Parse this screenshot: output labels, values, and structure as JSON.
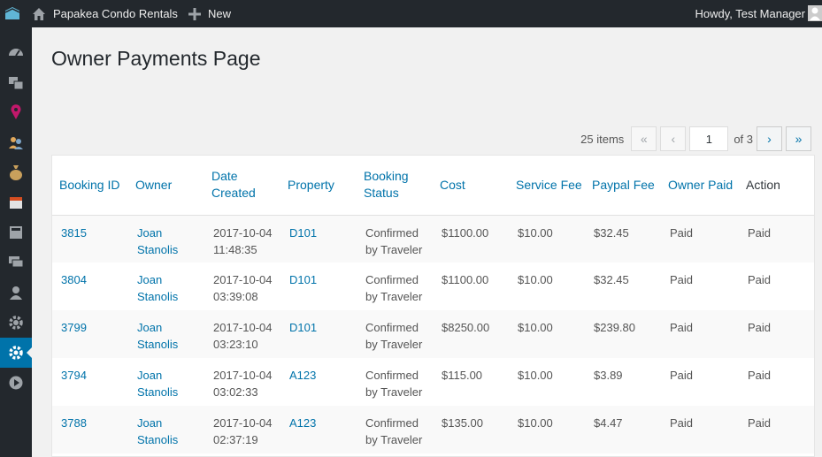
{
  "adminbar": {
    "site_name": "Papakea Condo Rentals",
    "new_label": "New",
    "greeting": "Howdy, Test Manager"
  },
  "sidebar": {
    "icons": [
      "dashboard-icon",
      "media-icon",
      "location-icon",
      "users-group-icon",
      "money-bag-icon",
      "calendar-icon",
      "calculator-icon",
      "comments-icon",
      "user-icon",
      "settings-icon",
      "settings-active-icon",
      "play-icon"
    ]
  },
  "page": {
    "title": "Owner Payments Page"
  },
  "pagination": {
    "items": "25 items",
    "first": "«",
    "prev": "‹",
    "current": "1",
    "of": "of 3",
    "next": "›",
    "last": "»"
  },
  "table": {
    "headers": [
      "Booking ID",
      "Owner",
      "Date Created",
      "Property",
      "Booking Status",
      "Cost",
      "Service Fee",
      "Paypal Fee",
      "Owner Paid",
      "Action"
    ],
    "rows": [
      {
        "id": "3815",
        "owner": "Joan Stanolis",
        "date": "2017-10-04 11:48:35",
        "property": "D101",
        "status": "Confirmed by Traveler",
        "cost": "$1100.00",
        "service": "$10.00",
        "paypal": "$32.45",
        "paid": "Paid",
        "action": "Paid"
      },
      {
        "id": "3804",
        "owner": "Joan Stanolis",
        "date": "2017-10-04 03:39:08",
        "property": "D101",
        "status": "Confirmed by Traveler",
        "cost": "$1100.00",
        "service": "$10.00",
        "paypal": "$32.45",
        "paid": "Paid",
        "action": "Paid"
      },
      {
        "id": "3799",
        "owner": "Joan Stanolis",
        "date": "2017-10-04 03:23:10",
        "property": "D101",
        "status": "Confirmed by Traveler",
        "cost": "$8250.00",
        "service": "$10.00",
        "paypal": "$239.80",
        "paid": "Paid",
        "action": "Paid"
      },
      {
        "id": "3794",
        "owner": "Joan Stanolis",
        "date": "2017-10-04 03:02:33",
        "property": "A123",
        "status": "Confirmed by Traveler",
        "cost": "$115.00",
        "service": "$10.00",
        "paypal": "$3.89",
        "paid": "Paid",
        "action": "Paid"
      },
      {
        "id": "3788",
        "owner": "Joan Stanolis",
        "date": "2017-10-04 02:37:19",
        "property": "A123",
        "status": "Confirmed by Traveler",
        "cost": "$135.00",
        "service": "$10.00",
        "paypal": "$4.47",
        "paid": "Paid",
        "action": "Paid"
      }
    ]
  },
  "colors": {
    "adminbar": "#23282d",
    "accent": "#0073aa",
    "background": "#f1f1f1"
  }
}
